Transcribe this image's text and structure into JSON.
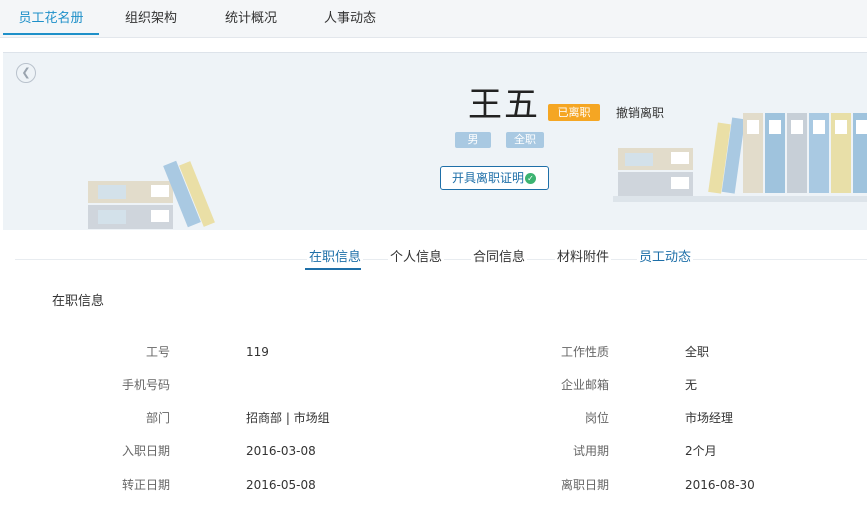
{
  "topnav": {
    "tabs": [
      {
        "label": "员工花名册"
      },
      {
        "label": "组织架构"
      },
      {
        "label": "统计概况"
      },
      {
        "label": "人事动态"
      }
    ]
  },
  "profile": {
    "name": "王五",
    "status_badge": "已离职",
    "revoke_label": "撤销离职",
    "gender": "男",
    "employment_type": "全职",
    "cert_button": "开具离职证明"
  },
  "subtabs": [
    {
      "label": "在职信息"
    },
    {
      "label": "个人信息"
    },
    {
      "label": "合同信息"
    },
    {
      "label": "材料附件"
    },
    {
      "label": "员工动态"
    }
  ],
  "section_title": "在职信息",
  "fields_left": [
    {
      "label": "工号",
      "value": "119"
    },
    {
      "label": "手机号码",
      "value": ""
    },
    {
      "label": "部门",
      "value": "招商部 | 市场组"
    },
    {
      "label": "入职日期",
      "value": "2016-03-08"
    },
    {
      "label": "转正日期",
      "value": "2016-05-08"
    }
  ],
  "fields_right": [
    {
      "label": "工作性质",
      "value": "全职"
    },
    {
      "label": "企业邮箱",
      "value": "无"
    },
    {
      "label": "岗位",
      "value": "市场经理"
    },
    {
      "label": "试用期",
      "value": "2个月"
    },
    {
      "label": "离职日期",
      "value": "2016-08-30"
    }
  ],
  "colors": {
    "accent": "#1e90c9",
    "status_orange": "#f5a623",
    "tag_blue": "#a9c9e2",
    "success_green": "#3cb371"
  }
}
